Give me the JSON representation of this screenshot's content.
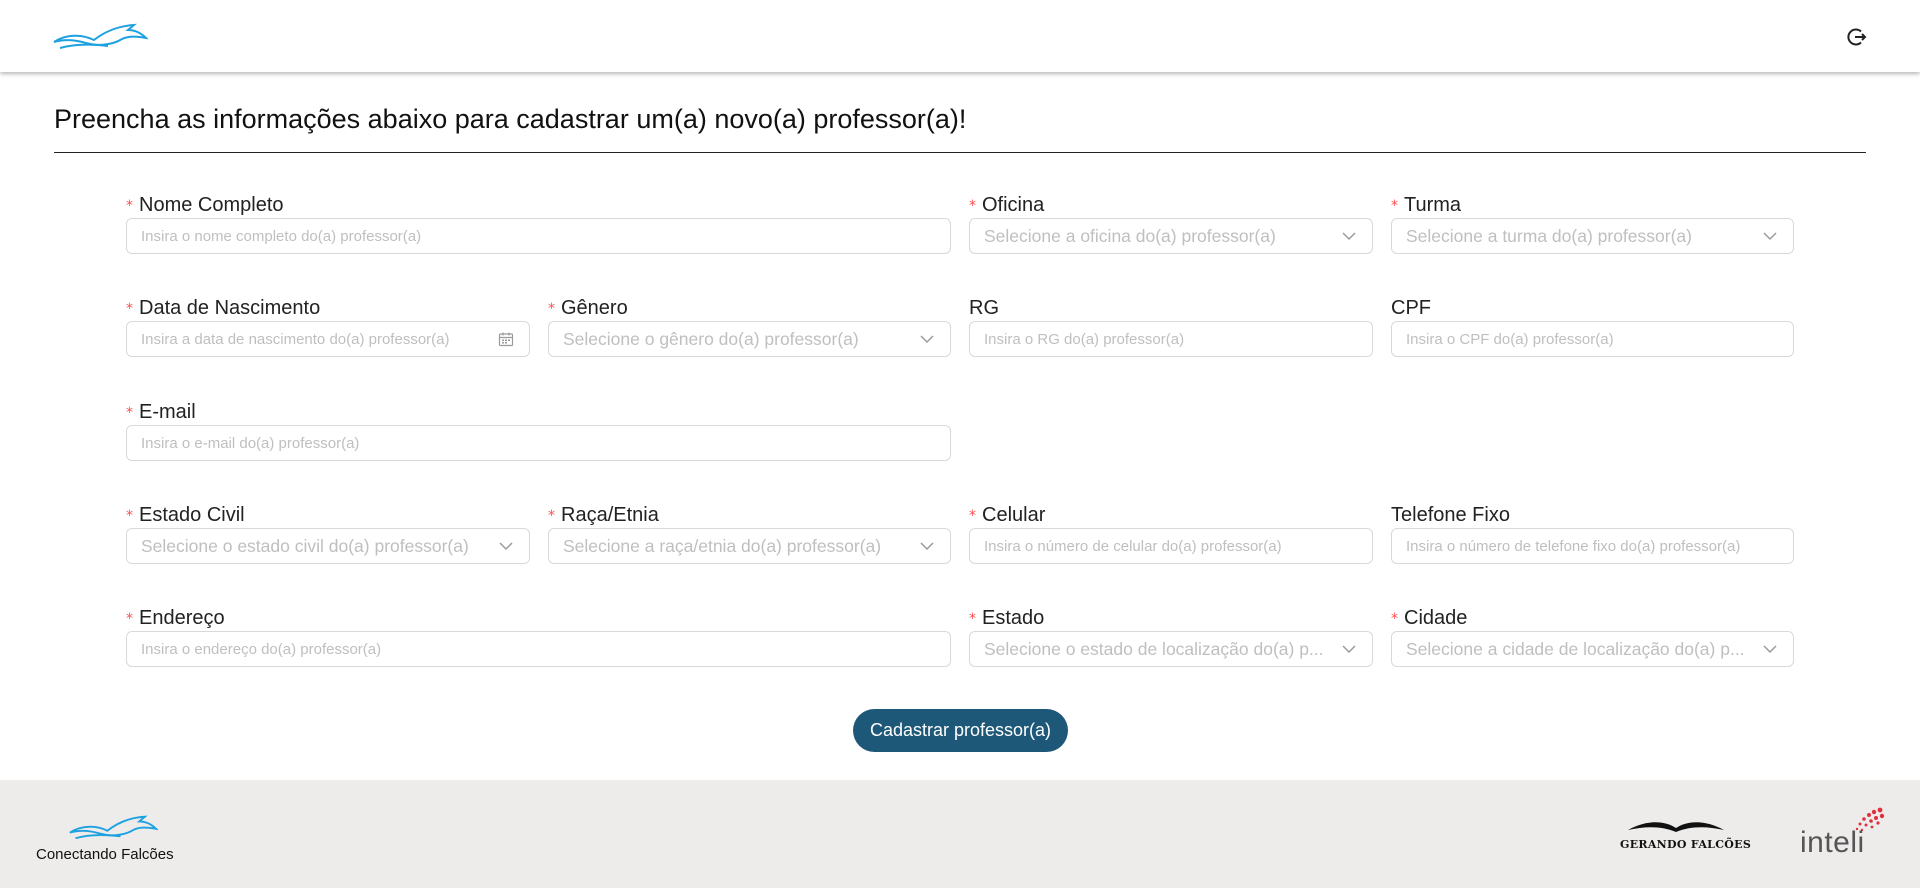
{
  "header": {
    "logo_icon": "falcon-logo-icon",
    "logout_icon": "logout-icon"
  },
  "page_title": "Preencha as informações abaixo para cadastrar um(a) novo(a) professor(a)!",
  "form": {
    "nome": {
      "label": "Nome Completo",
      "required": true,
      "placeholder": "Insira o nome completo do(a) professor(a)"
    },
    "oficina": {
      "label": "Oficina",
      "required": true,
      "placeholder": "Selecione a oficina do(a) professor(a)"
    },
    "turma": {
      "label": "Turma",
      "required": true,
      "placeholder": "Selecione a turma do(a) professor(a)"
    },
    "nascimento": {
      "label": "Data de Nascimento",
      "required": true,
      "placeholder": "Insira a data de nascimento do(a) professor(a)"
    },
    "genero": {
      "label": "Gênero",
      "required": true,
      "placeholder": "Selecione o gênero do(a) professor(a)"
    },
    "rg": {
      "label": "RG",
      "required": false,
      "placeholder": "Insira o RG do(a) professor(a)"
    },
    "cpf": {
      "label": "CPF",
      "required": false,
      "placeholder": "Insira o CPF do(a) professor(a)"
    },
    "email": {
      "label": "E-mail",
      "required": true,
      "placeholder": "Insira o e-mail do(a) professor(a)"
    },
    "estado_civil": {
      "label": "Estado Civil",
      "required": true,
      "placeholder": "Selecione o estado civil do(a) professor(a)"
    },
    "raca": {
      "label": "Raça/Etnia",
      "required": true,
      "placeholder": "Selecione a raça/etnia do(a) professor(a)"
    },
    "celular": {
      "label": "Celular",
      "required": true,
      "placeholder": "Insira o número de celular do(a) professor(a)"
    },
    "telefone": {
      "label": "Telefone Fixo",
      "required": false,
      "placeholder": "Insira o número de telefone fixo do(a) professor(a)"
    },
    "endereco": {
      "label": "Endereço",
      "required": true,
      "placeholder": "Insira o endereço do(a) professor(a)"
    },
    "estado": {
      "label": "Estado",
      "required": true,
      "placeholder": "Selecione o estado de localização do(a) p..."
    },
    "cidade": {
      "label": "Cidade",
      "required": true,
      "placeholder": "Selecione a cidade de localização do(a) p..."
    },
    "submit_label": "Cadastrar professor(a)"
  },
  "footer": {
    "brand_name": "Conectando Falcões",
    "partner_1": "GERANDO FALCÕES",
    "partner_2": "inteli"
  },
  "colors": {
    "accent": "#1e5878",
    "logo_blue": "#1da1e0",
    "required": "#ff4d4f",
    "footer_bg": "#eeeceb",
    "inteli_red": "#e0303e"
  }
}
